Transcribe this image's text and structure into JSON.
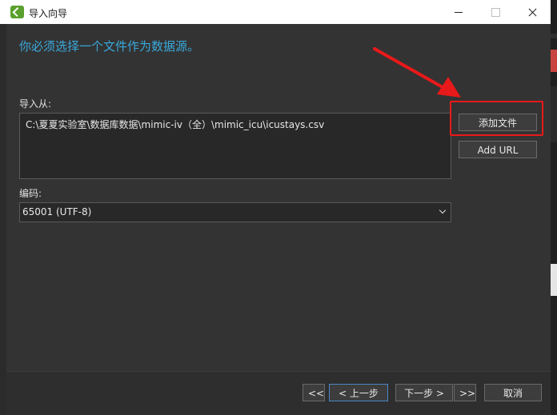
{
  "window": {
    "title": "导入向导"
  },
  "main": {
    "heading": "你必须选择一个文件作为数据源。",
    "import_from_label": "导入从:",
    "file_path": "C:\\夏夏实验室\\数据库数据\\mimic-iv（全）\\mimic_icu\\icustays.csv",
    "encoding_label": "编码:",
    "encoding_value": "65001 (UTF-8)"
  },
  "buttons": {
    "add_file": "添加文件",
    "add_url": "Add URL",
    "first": "<<",
    "prev": "< 上一步",
    "next": "下一步 >",
    "last": ">>",
    "cancel": "取消"
  },
  "colors": {
    "heading": "#39a9dc",
    "annotation": "#e8191a",
    "app_icon": "#5aa02c"
  },
  "icons": [
    "app-icon",
    "minimize-icon",
    "maximize-icon",
    "close-icon",
    "chevron-down-icon"
  ]
}
